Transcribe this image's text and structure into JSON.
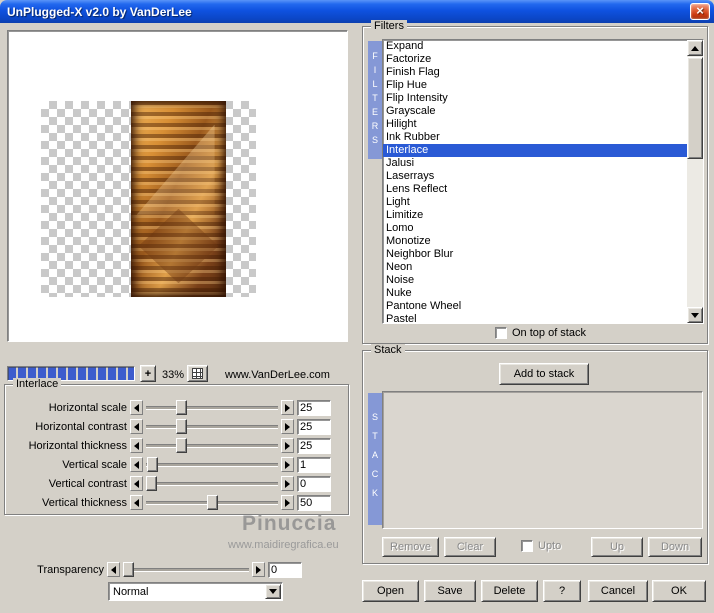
{
  "window": {
    "title": "UnPlugged-X v2.0 by VanDerLee",
    "close_glyph": "×"
  },
  "preview": {
    "zoom_level": "33%",
    "plus_label": "+",
    "website": "www.VanDerLee.com"
  },
  "filters": {
    "group_label": "Filters",
    "vertical_label": "FILTERS",
    "selected": "Interlace",
    "items": [
      "Expand",
      "Factorize",
      "Finish Flag",
      "Flip Hue",
      "Flip Intensity",
      "Grayscale",
      "Hilight",
      "Ink Rubber",
      "Interlace",
      "Jalusi",
      "Laserrays",
      "Lens Reflect",
      "Light",
      "Limitize",
      "Lomo",
      "Monotize",
      "Neighbor Blur",
      "Neon",
      "Noise",
      "Nuke",
      "Pantone Wheel",
      "Pastel"
    ],
    "on_top_label": "On top of stack"
  },
  "interlace": {
    "group_label": "Interlace",
    "sliders": [
      {
        "label": "Horizontal scale",
        "value": "25",
        "pos": 25
      },
      {
        "label": "Horizontal contrast",
        "value": "25",
        "pos": 25
      },
      {
        "label": "Horizontal thickness",
        "value": "25",
        "pos": 25
      },
      {
        "label": "Vertical scale",
        "value": "1",
        "pos": 1
      },
      {
        "label": "Vertical contrast",
        "value": "0",
        "pos": 0
      },
      {
        "label": "Vertical thickness",
        "value": "50",
        "pos": 50
      }
    ]
  },
  "blend": {
    "transparency_label": "Transparency",
    "transparency_value": "0",
    "transparency_pos": 0,
    "mode": "Normal"
  },
  "stack": {
    "group_label": "Stack",
    "vertical_label": "STACK",
    "add_button": "Add to stack",
    "remove_button": "Remove",
    "clear_button": "Clear",
    "upto_label": "Upto",
    "up_button": "Up",
    "down_button": "Down"
  },
  "footer": {
    "open": "Open",
    "save": "Save",
    "delete": "Delete",
    "help": "?",
    "cancel": "Cancel",
    "ok": "OK"
  },
  "watermark": {
    "name": "Pinuccia",
    "site": "www.maidiregrafica.eu"
  },
  "colors": {
    "titlebar_blue": "#0f52e0",
    "selection_blue": "#2a5ad5",
    "strip_blue": "#8598d6",
    "segment_blue": "#3d5ccd",
    "close_red": "#cc3a12"
  }
}
